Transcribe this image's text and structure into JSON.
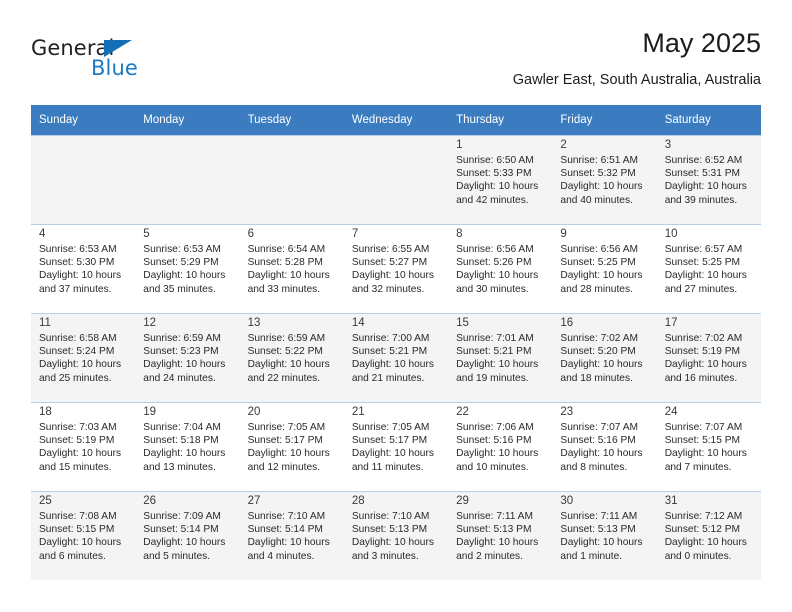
{
  "brand": {
    "name_part1": "General",
    "name_part2": "Blue",
    "accent_color": "#1a7ac4",
    "header_color": "#3b7cc0"
  },
  "header": {
    "title": "May 2025",
    "subtitle": "Gawler East, South Australia, Australia"
  },
  "weekday_headers": [
    "Sunday",
    "Monday",
    "Tuesday",
    "Wednesday",
    "Thursday",
    "Friday",
    "Saturday"
  ],
  "weeks": [
    [
      {
        "day": "",
        "details": ""
      },
      {
        "day": "",
        "details": ""
      },
      {
        "day": "",
        "details": ""
      },
      {
        "day": "",
        "details": ""
      },
      {
        "day": "1",
        "details": "Sunrise: 6:50 AM\nSunset: 5:33 PM\nDaylight: 10 hours\nand 42 minutes."
      },
      {
        "day": "2",
        "details": "Sunrise: 6:51 AM\nSunset: 5:32 PM\nDaylight: 10 hours\nand 40 minutes."
      },
      {
        "day": "3",
        "details": "Sunrise: 6:52 AM\nSunset: 5:31 PM\nDaylight: 10 hours\nand 39 minutes."
      }
    ],
    [
      {
        "day": "4",
        "details": "Sunrise: 6:53 AM\nSunset: 5:30 PM\nDaylight: 10 hours\nand 37 minutes."
      },
      {
        "day": "5",
        "details": "Sunrise: 6:53 AM\nSunset: 5:29 PM\nDaylight: 10 hours\nand 35 minutes."
      },
      {
        "day": "6",
        "details": "Sunrise: 6:54 AM\nSunset: 5:28 PM\nDaylight: 10 hours\nand 33 minutes."
      },
      {
        "day": "7",
        "details": "Sunrise: 6:55 AM\nSunset: 5:27 PM\nDaylight: 10 hours\nand 32 minutes."
      },
      {
        "day": "8",
        "details": "Sunrise: 6:56 AM\nSunset: 5:26 PM\nDaylight: 10 hours\nand 30 minutes."
      },
      {
        "day": "9",
        "details": "Sunrise: 6:56 AM\nSunset: 5:25 PM\nDaylight: 10 hours\nand 28 minutes."
      },
      {
        "day": "10",
        "details": "Sunrise: 6:57 AM\nSunset: 5:25 PM\nDaylight: 10 hours\nand 27 minutes."
      }
    ],
    [
      {
        "day": "11",
        "details": "Sunrise: 6:58 AM\nSunset: 5:24 PM\nDaylight: 10 hours\nand 25 minutes."
      },
      {
        "day": "12",
        "details": "Sunrise: 6:59 AM\nSunset: 5:23 PM\nDaylight: 10 hours\nand 24 minutes."
      },
      {
        "day": "13",
        "details": "Sunrise: 6:59 AM\nSunset: 5:22 PM\nDaylight: 10 hours\nand 22 minutes."
      },
      {
        "day": "14",
        "details": "Sunrise: 7:00 AM\nSunset: 5:21 PM\nDaylight: 10 hours\nand 21 minutes."
      },
      {
        "day": "15",
        "details": "Sunrise: 7:01 AM\nSunset: 5:21 PM\nDaylight: 10 hours\nand 19 minutes."
      },
      {
        "day": "16",
        "details": "Sunrise: 7:02 AM\nSunset: 5:20 PM\nDaylight: 10 hours\nand 18 minutes."
      },
      {
        "day": "17",
        "details": "Sunrise: 7:02 AM\nSunset: 5:19 PM\nDaylight: 10 hours\nand 16 minutes."
      }
    ],
    [
      {
        "day": "18",
        "details": "Sunrise: 7:03 AM\nSunset: 5:19 PM\nDaylight: 10 hours\nand 15 minutes."
      },
      {
        "day": "19",
        "details": "Sunrise: 7:04 AM\nSunset: 5:18 PM\nDaylight: 10 hours\nand 13 minutes."
      },
      {
        "day": "20",
        "details": "Sunrise: 7:05 AM\nSunset: 5:17 PM\nDaylight: 10 hours\nand 12 minutes."
      },
      {
        "day": "21",
        "details": "Sunrise: 7:05 AM\nSunset: 5:17 PM\nDaylight: 10 hours\nand 11 minutes."
      },
      {
        "day": "22",
        "details": "Sunrise: 7:06 AM\nSunset: 5:16 PM\nDaylight: 10 hours\nand 10 minutes."
      },
      {
        "day": "23",
        "details": "Sunrise: 7:07 AM\nSunset: 5:16 PM\nDaylight: 10 hours\nand 8 minutes."
      },
      {
        "day": "24",
        "details": "Sunrise: 7:07 AM\nSunset: 5:15 PM\nDaylight: 10 hours\nand 7 minutes."
      }
    ],
    [
      {
        "day": "25",
        "details": "Sunrise: 7:08 AM\nSunset: 5:15 PM\nDaylight: 10 hours\nand 6 minutes."
      },
      {
        "day": "26",
        "details": "Sunrise: 7:09 AM\nSunset: 5:14 PM\nDaylight: 10 hours\nand 5 minutes."
      },
      {
        "day": "27",
        "details": "Sunrise: 7:10 AM\nSunset: 5:14 PM\nDaylight: 10 hours\nand 4 minutes."
      },
      {
        "day": "28",
        "details": "Sunrise: 7:10 AM\nSunset: 5:13 PM\nDaylight: 10 hours\nand 3 minutes."
      },
      {
        "day": "29",
        "details": "Sunrise: 7:11 AM\nSunset: 5:13 PM\nDaylight: 10 hours\nand 2 minutes."
      },
      {
        "day": "30",
        "details": "Sunrise: 7:11 AM\nSunset: 5:13 PM\nDaylight: 10 hours\nand 1 minute."
      },
      {
        "day": "31",
        "details": "Sunrise: 7:12 AM\nSunset: 5:12 PM\nDaylight: 10 hours\nand 0 minutes."
      }
    ]
  ]
}
